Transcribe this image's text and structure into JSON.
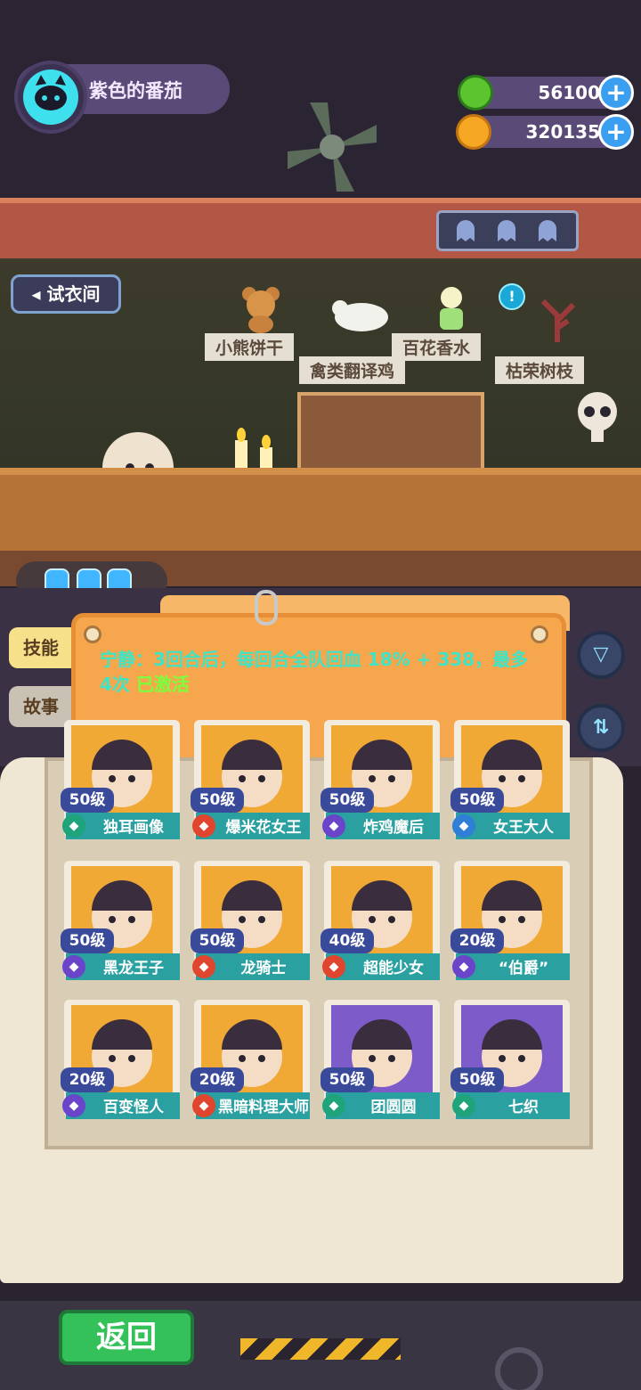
{
  "user": {
    "name": "紫色的番茄"
  },
  "currencies": [
    {
      "id": "gem",
      "value": "56100",
      "color": "#5cc42e"
    },
    {
      "id": "coin",
      "value": "320135",
      "color": "#f5a623"
    }
  ],
  "scene": {
    "fitting_room": "试衣间",
    "shelf_items": [
      "小熊饼干",
      "禽类翻译鸡",
      "百花香水",
      "枯荣树枝"
    ]
  },
  "tabs": {
    "skill": "技能",
    "story": "故事"
  },
  "panel": {
    "text": "宁静：3回合后，每回合全队回血 18% + 338，最多4次",
    "status": "已激活"
  },
  "characters": [
    {
      "level": "50级",
      "name": "独耳画像",
      "type_color": "#1fa37a",
      "bg": "orange"
    },
    {
      "level": "50级",
      "name": "爆米花女王",
      "type_color": "#e0452e",
      "bg": "orange"
    },
    {
      "level": "50级",
      "name": "炸鸡魔后",
      "type_color": "#6a45c9",
      "bg": "orange"
    },
    {
      "level": "50级",
      "name": "女王大人",
      "type_color": "#2f7fd6",
      "bg": "orange"
    },
    {
      "level": "50级",
      "name": "黑龙王子",
      "type_color": "#6a45c9",
      "bg": "orange"
    },
    {
      "level": "50级",
      "name": "龙骑士",
      "type_color": "#e0452e",
      "bg": "orange"
    },
    {
      "level": "40级",
      "name": "超能少女",
      "type_color": "#e0452e",
      "bg": "orange"
    },
    {
      "level": "20级",
      "name": "“伯爵”",
      "type_color": "#6a45c9",
      "bg": "orange"
    },
    {
      "level": "20级",
      "name": "百变怪人",
      "type_color": "#6a45c9",
      "bg": "orange"
    },
    {
      "level": "20级",
      "name": "黑暗料理大师",
      "type_color": "#e0452e",
      "bg": "orange"
    },
    {
      "level": "50级",
      "name": "团圆圆",
      "type_color": "#1fa37a",
      "bg": "purple"
    },
    {
      "level": "50级",
      "name": "七织",
      "type_color": "#1fa37a",
      "bg": "purple"
    }
  ],
  "back_button": "返回"
}
